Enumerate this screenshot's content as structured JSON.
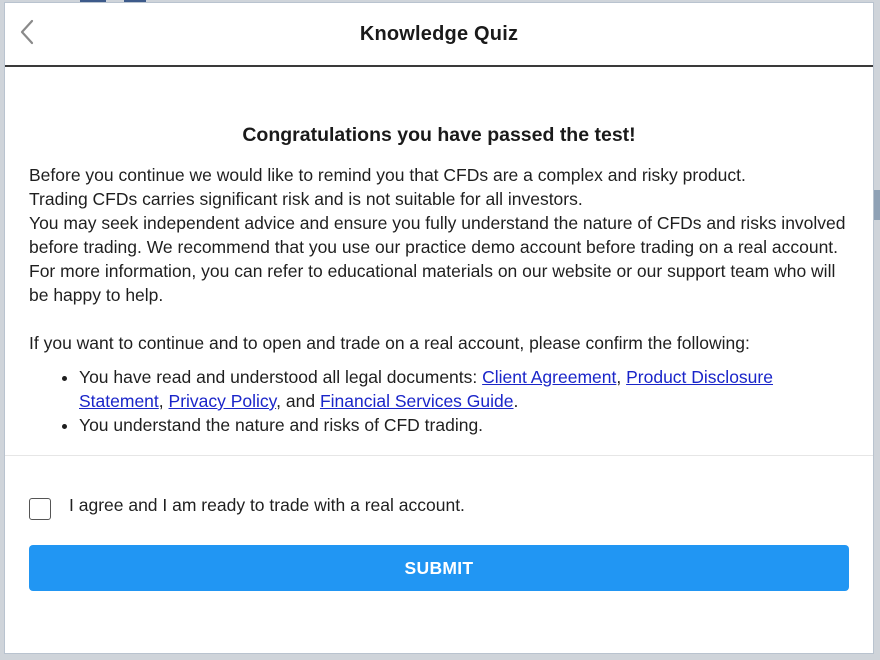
{
  "dialog": {
    "title": "Knowledge Quiz",
    "back_icon": "chevron-left-icon"
  },
  "content": {
    "heading": "Congratulations you have passed the test!",
    "paragraphs": [
      "Before you continue we would like to remind you that CFDs are a complex and risky product.",
      "Trading CFDs carries significant risk and is not suitable for all investors.",
      "You may seek independent advice and ensure you fully understand the nature of CFDs and risks involved before trading. We recommend that you use our practice demo account before trading on a real account. For more information, you can refer to educational materials on our website or our support team who will be happy to help."
    ],
    "confirm_intro": "If you want to continue and to open and trade on a real account, please confirm the following:",
    "bullet1_prefix": "You have read and understood all legal documents: ",
    "links": {
      "client_agreement": "Client Agreement",
      "pds": "Product Disclosure Statement",
      "privacy_policy": "Privacy Policy",
      "fsg": "Financial Services Guide"
    },
    "sep_comma": ", ",
    "sep_and": ", and ",
    "period": ".",
    "bullet2": "You understand the nature and risks of CFD trading."
  },
  "agreement": {
    "label": "I agree and I am ready to trade with a real account.",
    "checked": false
  },
  "submit": {
    "label": "SUBMIT",
    "color": "#2196f3"
  },
  "colors": {
    "link": "#1a25c9",
    "accent": "#2196f3"
  }
}
